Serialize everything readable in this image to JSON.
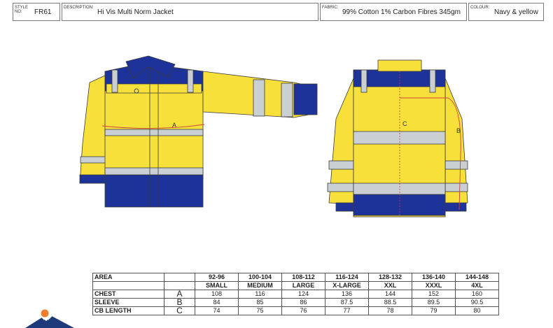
{
  "header": {
    "style_label": "STYLE NO:",
    "style_value": "FR61",
    "description_label": "DESCRIPTION:",
    "description_value": "Hi Vis Multi Norm Jacket",
    "fabric_label": "FABRIC:",
    "fabric_value": "99% Cotton 1% Carbon Fibres 345gm",
    "colour_label": "COLOUR:",
    "colour_value": "Navy & yellow"
  },
  "drawing": {
    "front_marker": "A",
    "back_marker_c": "C",
    "back_marker_b": "B",
    "colors": {
      "yellow": "#f7e03a",
      "navy": "#1e3399",
      "reflective": "#c9cfd3",
      "outline": "#3a3a3a",
      "measure": "#d04040"
    }
  },
  "table": {
    "area_label": "AREA",
    "size_ranges": [
      "92-96",
      "100-104",
      "108-112",
      "116-124",
      "128-132",
      "136-140",
      "144-148"
    ],
    "size_labels": [
      "SMALL",
      "MEDIUM",
      "LARGE",
      "X-LARGE",
      "XXL",
      "XXXL",
      "4XL"
    ],
    "rows": [
      {
        "name": "CHEST",
        "code": "A",
        "values": [
          "108",
          "116",
          "124",
          "136",
          "144",
          "152",
          "160"
        ]
      },
      {
        "name": "SLEEVE",
        "code": "B",
        "values": [
          "84",
          "85",
          "86",
          "87.5",
          "88.5",
          "89.5",
          "90.5"
        ]
      },
      {
        "name": "CB LENGTH",
        "code": "C",
        "values": [
          "74",
          "75",
          "76",
          "77",
          "78",
          "79",
          "80"
        ]
      }
    ]
  },
  "logo": {
    "icon": "mountain-logo-icon",
    "colors": {
      "sun": "#f07d2c",
      "mountain": "#1f3a7a"
    }
  }
}
